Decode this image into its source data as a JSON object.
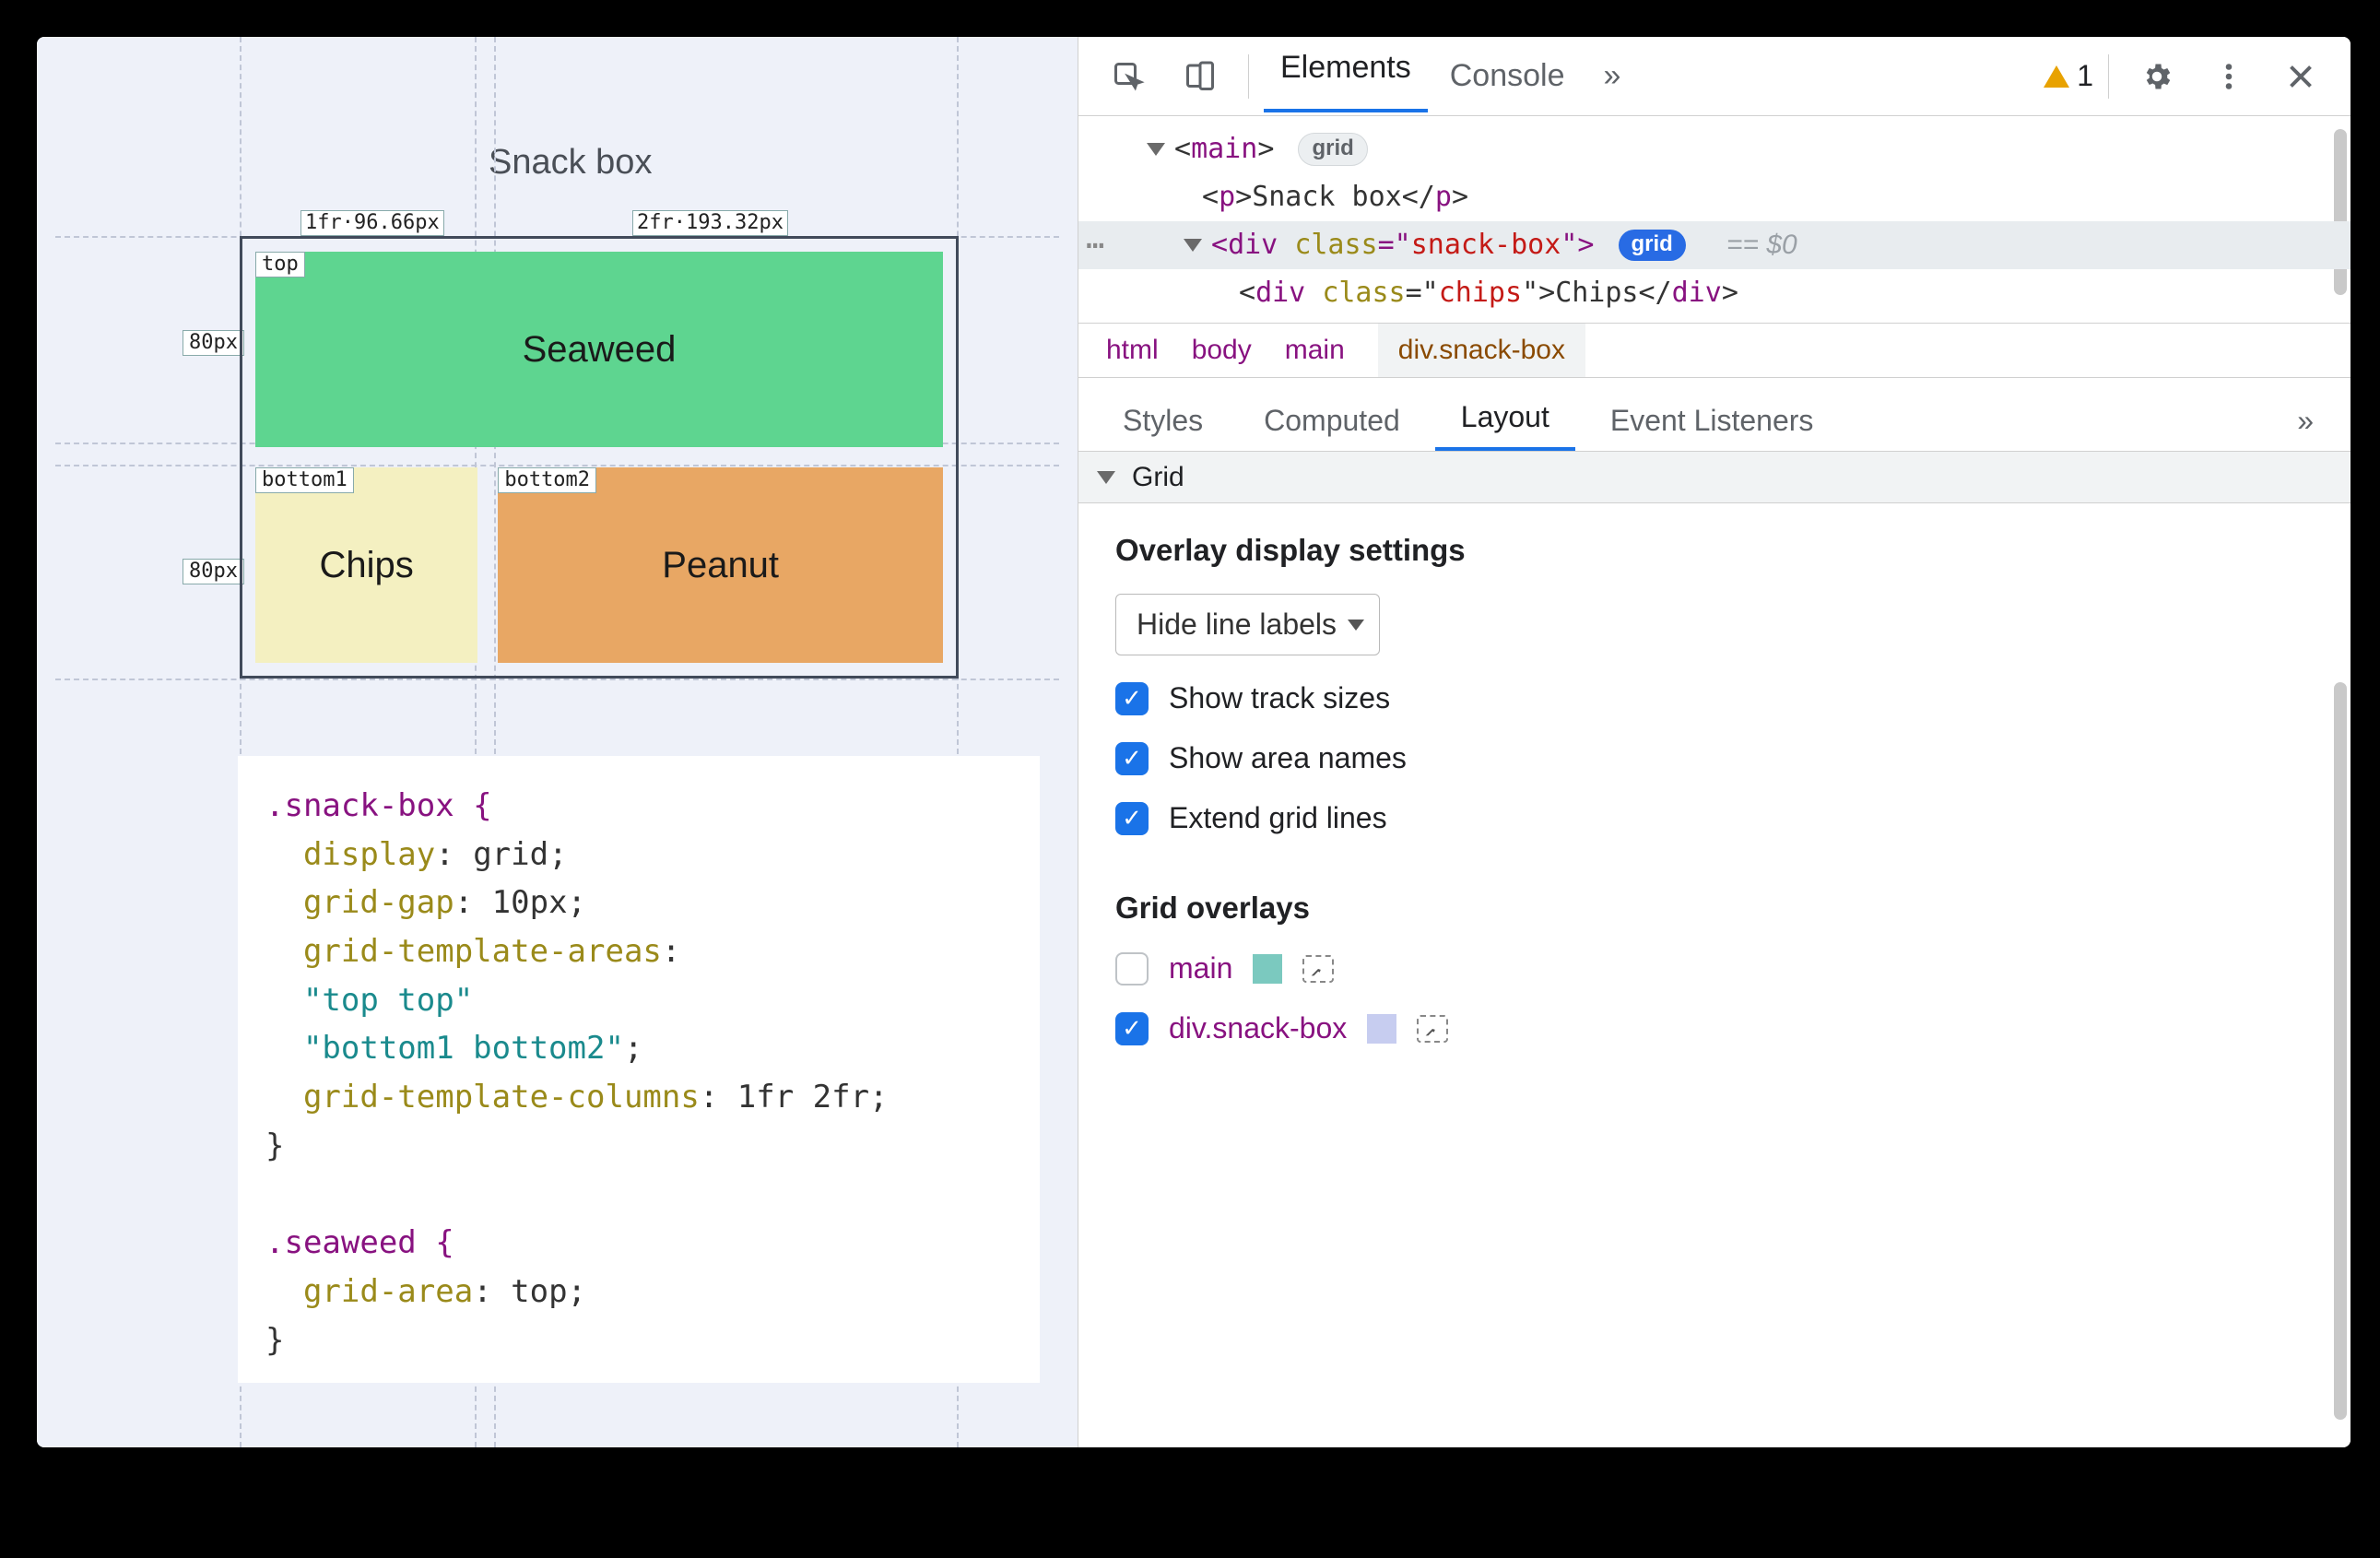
{
  "page": {
    "title": "Snack box",
    "tracks": {
      "col1": "1fr·96.66px",
      "col2": "2fr·193.32px",
      "row": "80px"
    },
    "areas": {
      "top": "top",
      "b1": "bottom1",
      "b2": "bottom2"
    },
    "cells": {
      "seaweed": "Seaweed",
      "chips": "Chips",
      "peanut": "Peanut"
    }
  },
  "css": {
    "line1": ".snack-box {",
    "l2p": "display",
    "l2v": ": grid;",
    "l3p": "grid-gap",
    "l3v": ": 10px;",
    "l4p": "grid-template-areas",
    "l4v": ":",
    "l5": "\"top top\"",
    "l6": "\"bottom1 bottom2\"",
    "l6t": ";",
    "l7p": "grid-template-columns",
    "l7v": ": 1fr 2fr;",
    "l8": "}",
    "l10": ".seaweed {",
    "l11p": "grid-area",
    "l11v": ": top;",
    "l12": "}"
  },
  "devtools": {
    "tabs": {
      "elements": "Elements",
      "console": "Console"
    },
    "more": "»",
    "warnCount": "1",
    "dom": {
      "mainOpen": "main",
      "gridBadge": "grid",
      "pText": "Snack box",
      "divClass": "snack-box",
      "gridBadge2": "grid",
      "eq0": "== $0",
      "chipsClass": "chips",
      "chipsText": "Chips"
    },
    "crumbs": {
      "html": "html",
      "body": "body",
      "main": "main",
      "snack": "div.snack-box"
    },
    "panes": {
      "styles": "Styles",
      "computed": "Computed",
      "layout": "Layout",
      "listeners": "Event Listeners"
    },
    "section": "Grid",
    "overlayHead": "Overlay display settings",
    "selectLabel": "Hide line labels",
    "opt1": "Show track sizes",
    "opt2": "Show area names",
    "opt3": "Extend grid lines",
    "gridOverlaysHead": "Grid overlays",
    "ov1": "main",
    "ov2": "div.snack-box",
    "swatches": {
      "main": "#7bc9bf",
      "snack": "#c7cdf0"
    }
  }
}
